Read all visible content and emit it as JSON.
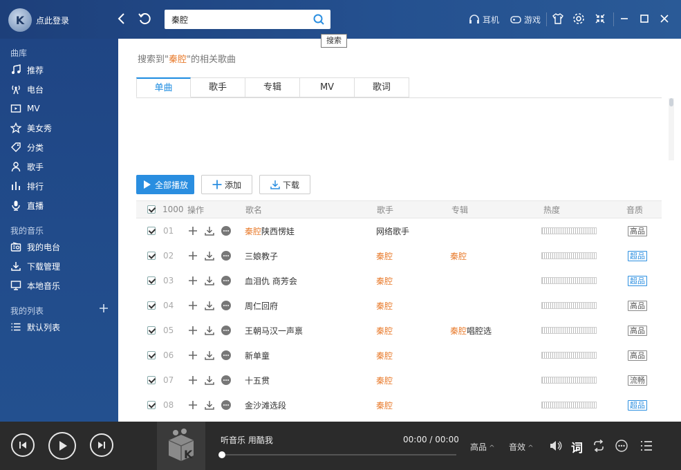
{
  "top": {
    "login": "点此登录",
    "search_value": "秦腔",
    "search_tooltip": "搜索",
    "headphones": "耳机",
    "games": "游戏"
  },
  "sidebar": {
    "library_title": "曲库",
    "library": [
      "推荐",
      "电台",
      "MV",
      "美女秀",
      "分类",
      "歌手",
      "排行",
      "直播"
    ],
    "my_music_title": "我的音乐",
    "my_music": [
      "我的电台",
      "下载管理",
      "本地音乐"
    ],
    "playlists_title": "我的列表",
    "playlists": [
      "默认列表"
    ]
  },
  "main": {
    "result_prefix": "搜索到\"",
    "result_keyword": "秦腔",
    "result_suffix": "\"的相关歌曲",
    "tabs": [
      "单曲",
      "歌手",
      "专辑",
      "MV",
      "歌词"
    ],
    "buttons": {
      "play_all": "全部播放",
      "add": "添加",
      "download": "下载"
    },
    "table": {
      "count": "1000",
      "headers": {
        "ops": "操作",
        "song": "歌名",
        "artist": "歌手",
        "album": "专辑",
        "heat": "热度",
        "quality": "音质"
      },
      "rows": [
        {
          "idx": "01",
          "song_kw": "秦腔",
          "song_rest": " 陕西愣娃",
          "artist": "网络歌手",
          "artist_plain": true,
          "album_kw": "",
          "album_rest": "",
          "quality": "高品",
          "super": false
        },
        {
          "idx": "02",
          "song_kw": "",
          "song_rest": "三娘教子",
          "artist": "秦腔",
          "artist_plain": false,
          "album_kw": "秦腔",
          "album_rest": "",
          "quality": "超品",
          "super": true
        },
        {
          "idx": "03",
          "song_kw": "",
          "song_rest": "血泪仇 商芳会",
          "artist": "秦腔",
          "artist_plain": false,
          "album_kw": "",
          "album_rest": "",
          "quality": "超品",
          "super": true
        },
        {
          "idx": "04",
          "song_kw": "",
          "song_rest": "周仁回府",
          "artist": "秦腔",
          "artist_plain": false,
          "album_kw": "",
          "album_rest": "",
          "quality": "高品",
          "super": false
        },
        {
          "idx": "05",
          "song_kw": "",
          "song_rest": "王朝马汉一声禀",
          "artist": "秦腔",
          "artist_plain": false,
          "album_kw": "秦腔",
          "album_rest": "唱腔选",
          "quality": "高品",
          "super": false
        },
        {
          "idx": "06",
          "song_kw": "",
          "song_rest": "新单童",
          "artist": "秦腔",
          "artist_plain": false,
          "album_kw": "",
          "album_rest": "",
          "quality": "高品",
          "super": false
        },
        {
          "idx": "07",
          "song_kw": "",
          "song_rest": "十五贯",
          "artist": "秦腔",
          "artist_plain": false,
          "album_kw": "",
          "album_rest": "",
          "quality": "流畅",
          "super": false
        },
        {
          "idx": "08",
          "song_kw": "",
          "song_rest": "金沙滩选段",
          "artist": "秦腔",
          "artist_plain": false,
          "album_kw": "",
          "album_rest": "",
          "quality": "超品",
          "super": true
        }
      ]
    }
  },
  "player": {
    "title": "听音乐 用酷我",
    "time": "00:00 / 00:00",
    "quality": "高品",
    "effects": "音效",
    "lyrics": "词",
    "progress": 0
  },
  "colors": {
    "accent": "#2a8ee0",
    "keyword": "#e87a2b",
    "sidebar": "#214b8a",
    "player": "#2b2b2b"
  }
}
